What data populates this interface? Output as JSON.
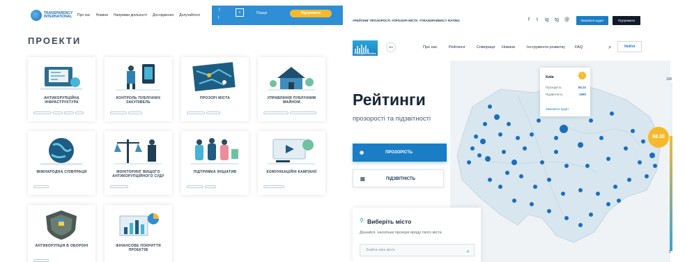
{
  "left": {
    "header": {
      "logo_text": "TRANSPARENCY INTERNATIONAL",
      "nav": [
        "Про нас",
        "Новини",
        "Напрямки діяльності",
        "Дослідження",
        "Долучайтеся"
      ],
      "social": [
        "f",
        "t",
        "in"
      ],
      "search_label": "Пошук",
      "support_label": "Підтримати"
    },
    "title": "ПРОЕКТИ",
    "cards": [
      {
        "name": "АНТИКОРУПЦІЙНА ІНФРАСТРУКТУРА"
      },
      {
        "name": "КОНТРОЛЬ ПУБЛІЧНИХ ЗАКУПІВЕЛЬ"
      },
      {
        "name": "ПРОЗОРІ МІСТА"
      },
      {
        "name": "УПРАВЛІННЯ ПУБЛІЧНИМ МАЙНОМ"
      },
      {
        "name": "МІЖНАРОДНА СПІВПРАЦЯ"
      },
      {
        "name": "МОНІТОРИНГ ВИЩОГО АНТИКОРУПЦІЙНОГО СУДУ"
      },
      {
        "name": "ПІДТРИМКА ІНІЦІАТИВ"
      },
      {
        "name": "КОМУНІКАЦІЙНІ КАМПАНІЇ"
      },
      {
        "name": "АНТИКОРУПЦІЯ В ОБОРОНІ"
      },
      {
        "name": "ФІНАНСОВЕ ПОКРИТТЯ ПРОЕКТІВ"
      }
    ]
  },
  "right": {
    "topbar": {
      "tags": [
        "#РЕЙТИНГ ПРОЗОРОСТІ",
        "#ПРОЗОРІ МІСТА",
        "#TRANSPARENCY RATING"
      ],
      "social": [
        "f",
        "t",
        "ig",
        "tg",
        "@"
      ],
      "btn_blue": "Замовити аудит",
      "btn_dark": "Підтримати"
    },
    "nav": {
      "logo_text": "#TransparentCities",
      "lang": "UA",
      "items": [
        "Про нас",
        "Рейтинги",
        "Співпраця",
        "Новини",
        "Інструменти розвитку",
        "FAQ"
      ],
      "login": "Увійти"
    },
    "heading": "Рейтинги",
    "subheading": "прозорості та підзвітності",
    "tab_transparency": "ПРОЗОРІСТЬ",
    "tab_accountability": "ПІДЗВІТНІСТЬ",
    "city_panel": {
      "title": "Виберіть місто",
      "desc": "Дізнайся, наскільки прозоре вряду твого міста",
      "placeholder": "Знайти своє місто"
    },
    "popup": {
      "city": "Київ",
      "badge": "1",
      "row1_label": "Прозорість",
      "row1_value": "68.20",
      "row2_label": "Підзвітність",
      "row2_value": "1990",
      "link": "Замовити аудит"
    },
    "scale": {
      "max": "100",
      "min": "0",
      "value": "68.20",
      "value_fraction": 0.68
    }
  }
}
